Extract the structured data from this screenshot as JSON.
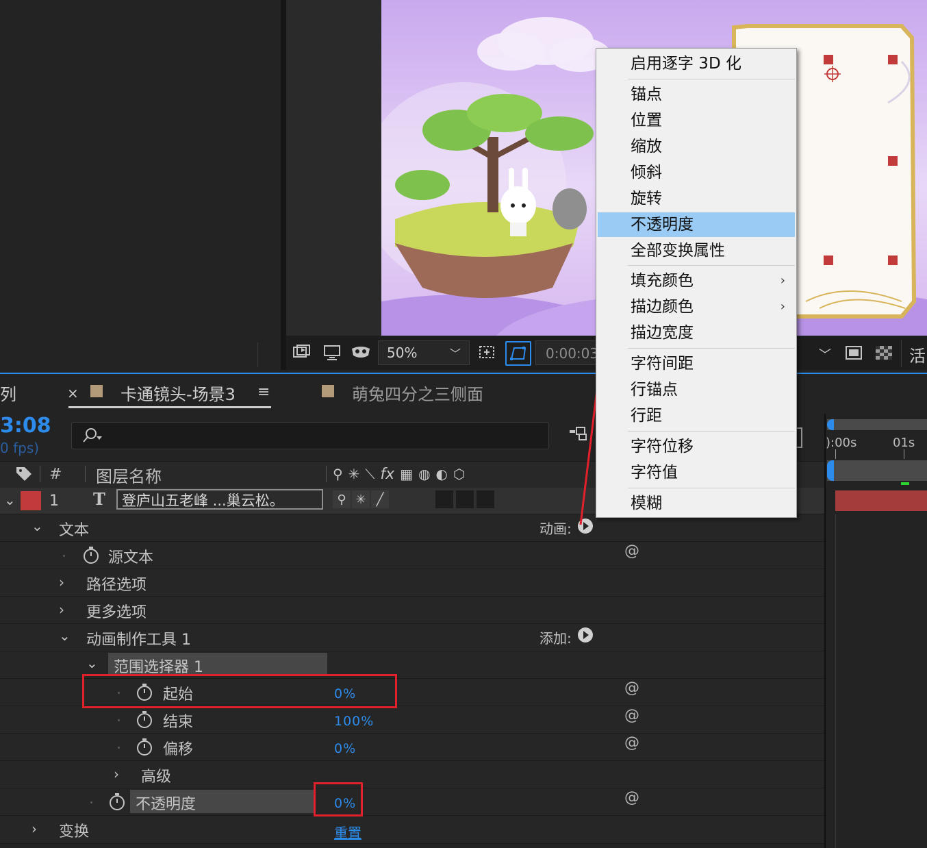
{
  "viewer": {
    "zoom": "50%",
    "timecode": "0:00:03",
    "right_label": "活"
  },
  "tabs": {
    "left_partial": "列",
    "close": "×",
    "active": "卡通镜头-场景3",
    "menu": "≡",
    "second": "萌兔四分之三侧面"
  },
  "timeline": {
    "timecode": "3:08",
    "fps": "0 fps)",
    "search_icon": "search-icon",
    "ruler_start": "):00s",
    "ruler_01s": "01s"
  },
  "columns": {
    "hash": "#",
    "layer_name": "图层名称"
  },
  "layer": {
    "number": "1",
    "type_icon": "T",
    "name": "登庐山五老峰 ...巢云松。"
  },
  "properties": {
    "text": "文本",
    "animate_label": "动画:",
    "source_text": "源文本",
    "path_options": "路径选项",
    "more_options": "更多选项",
    "animator": "动画制作工具 1",
    "add_label": "添加:",
    "range_selector": "范围选择器 1",
    "start": "起始",
    "start_value": "0%",
    "end": "结束",
    "end_value": "100%",
    "offset": "偏移",
    "offset_value": "0%",
    "advanced": "高级",
    "opacity": "不透明度",
    "opacity_value": "0%",
    "transform": "变换",
    "reset": "重置"
  },
  "context_menu": {
    "items": [
      "启用逐字 3D 化",
      "锚点",
      "位置",
      "缩放",
      "倾斜",
      "旋转",
      "不透明度",
      "全部变换属性",
      "填充颜色",
      "描边颜色",
      "描边宽度",
      "字符间距",
      "行锚点",
      "行距",
      "字符位移",
      "字符值",
      "模糊"
    ],
    "selected": "不透明度",
    "submenu_arrow": "›"
  },
  "colors": {
    "accent_blue": "#2d8ceb",
    "menu_highlight": "#99cbf4",
    "annotation_red": "#e0202a",
    "layer_label": "#c23a3a"
  }
}
